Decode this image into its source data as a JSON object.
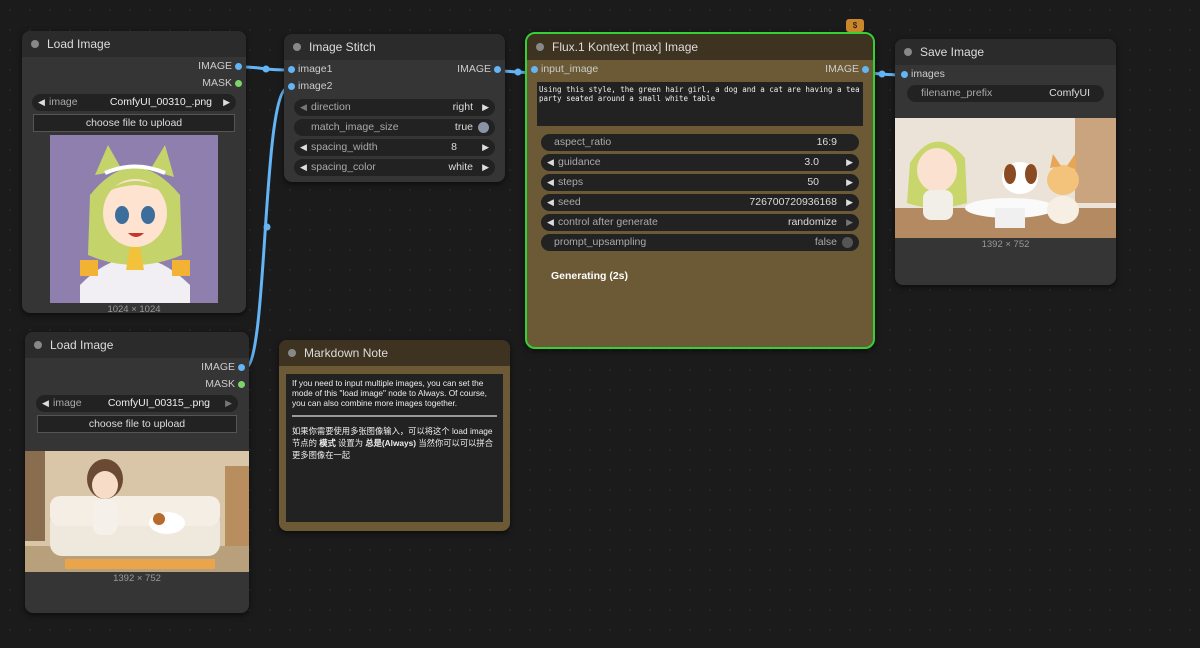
{
  "colors": {
    "link": "#64b5f6",
    "slot": "#64b5f6",
    "selected_border": "#33d133",
    "api_node": "#6b5a35",
    "note_node": "#6b5a35"
  },
  "load_image_1": {
    "title": "Load Image",
    "out_image": "IMAGE",
    "out_mask": "MASK",
    "image_label": "image",
    "image_value": "ComfyUI_00310_.png",
    "upload_button": "choose file to upload",
    "dimensions": "1024 × 1024"
  },
  "load_image_2": {
    "title": "Load Image",
    "out_image": "IMAGE",
    "out_mask": "MASK",
    "image_label": "image",
    "image_value": "ComfyUI_00315_.png",
    "upload_button": "choose file to upload",
    "dimensions": "1392 × 752"
  },
  "image_stitch": {
    "title": "Image Stitch",
    "in_image1": "image1",
    "in_image2": "image2",
    "out_image": "IMAGE",
    "widgets": [
      {
        "label": "direction",
        "value": "right"
      },
      {
        "label": "match_image_size",
        "value": "true"
      },
      {
        "label": "spacing_width",
        "value": "8"
      },
      {
        "label": "spacing_color",
        "value": "white"
      }
    ]
  },
  "flux": {
    "title": "Flux.1 Kontext [max] Image",
    "badge": "$",
    "in_input_image": "input_image",
    "out_image": "IMAGE",
    "prompt": "Using this style, the green hair girl, a dog and a cat are having a tea party seated around a small white table",
    "widgets": [
      {
        "label": "aspect_ratio",
        "value": "16:9"
      },
      {
        "label": "guidance",
        "value": "3.0"
      },
      {
        "label": "steps",
        "value": "50"
      },
      {
        "label": "seed",
        "value": "726700720936168"
      },
      {
        "label": "control after generate",
        "value": "randomize"
      },
      {
        "label": "prompt_upsampling",
        "value": "false"
      }
    ],
    "status": "Generating (2s)"
  },
  "save_image": {
    "title": "Save Image",
    "in_images": "images",
    "prefix_label": "filename_prefix",
    "prefix_value": "ComfyUI",
    "dimensions": "1392 × 752"
  },
  "markdown_note": {
    "title": "Markdown Note",
    "text_en": "If you need to input multiple images, you can set the mode of this \"load image\" node to Always. Of course, you can also combine more images together.",
    "text_zh_1": "如果你需要使用多张图像输入，可以将这个 load image 节点的 ",
    "text_zh_bold_1": "模式",
    "text_zh_2": " 设置为 ",
    "text_zh_bold_2": "总是(Always)",
    "text_zh_3": " 当然你可以可以拼合更多图像在一起"
  }
}
